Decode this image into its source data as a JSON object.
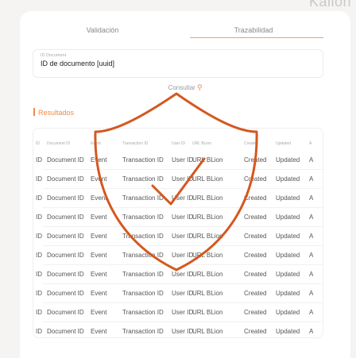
{
  "brand": "Kallon",
  "tabs": [
    {
      "label": "Validación"
    },
    {
      "label": "Trazabilidad"
    }
  ],
  "search": {
    "label": "ID Document",
    "value": "ID de documento [uuid]"
  },
  "consult": {
    "label": "Consultar",
    "icon": "search-icon"
  },
  "results": {
    "label": "Resultados"
  },
  "table": {
    "headers": [
      "ID",
      "Document ID",
      "Event",
      "Transaction ID",
      "User ID",
      "URL BLion",
      "Created",
      "Updated",
      "A"
    ],
    "rows": [
      [
        "ID",
        "Document ID",
        "Event",
        "Transaction ID",
        "User ID",
        "URL BLion",
        "Created",
        "Updated",
        "A"
      ],
      [
        "ID",
        "Document ID",
        "Event",
        "Transaction ID",
        "User ID",
        "URL BLion",
        "Created",
        "Updated",
        "A"
      ],
      [
        "ID",
        "Document ID",
        "Event",
        "Transaction ID",
        "User ID",
        "URL BLion",
        "Created",
        "Updated",
        "A"
      ],
      [
        "ID",
        "Document ID",
        "Event",
        "Transaction ID",
        "User ID",
        "URL BLion",
        "Created",
        "Updated",
        "A"
      ],
      [
        "ID",
        "Document ID",
        "Event",
        "Transaction ID",
        "User ID",
        "URL BLion",
        "Created",
        "Updated",
        "A"
      ],
      [
        "ID",
        "Document ID",
        "Event",
        "Transaction ID",
        "User ID",
        "URL BLion",
        "Created",
        "Updated",
        "A"
      ],
      [
        "ID",
        "Document ID",
        "Event",
        "Transaction ID",
        "User ID",
        "URL BLion",
        "Created",
        "Updated",
        "A"
      ],
      [
        "ID",
        "Document ID",
        "Event",
        "Transaction ID",
        "User ID",
        "URL BLion",
        "Created",
        "Updated",
        "A"
      ],
      [
        "ID",
        "Document ID",
        "Event",
        "Transaction ID",
        "User ID",
        "URL BLion",
        "Created",
        "Updated",
        "A"
      ],
      [
        "ID",
        "Document ID",
        "Event",
        "Transaction ID",
        "User ID",
        "URL BLion",
        "Created",
        "Updated",
        "A"
      ]
    ]
  },
  "overlay": {
    "icon": "shield-check-icon",
    "color": "#d4581f"
  },
  "colors": {
    "accent": "#f08a45",
    "background": "#f5f4f2",
    "card": "#ffffff"
  }
}
